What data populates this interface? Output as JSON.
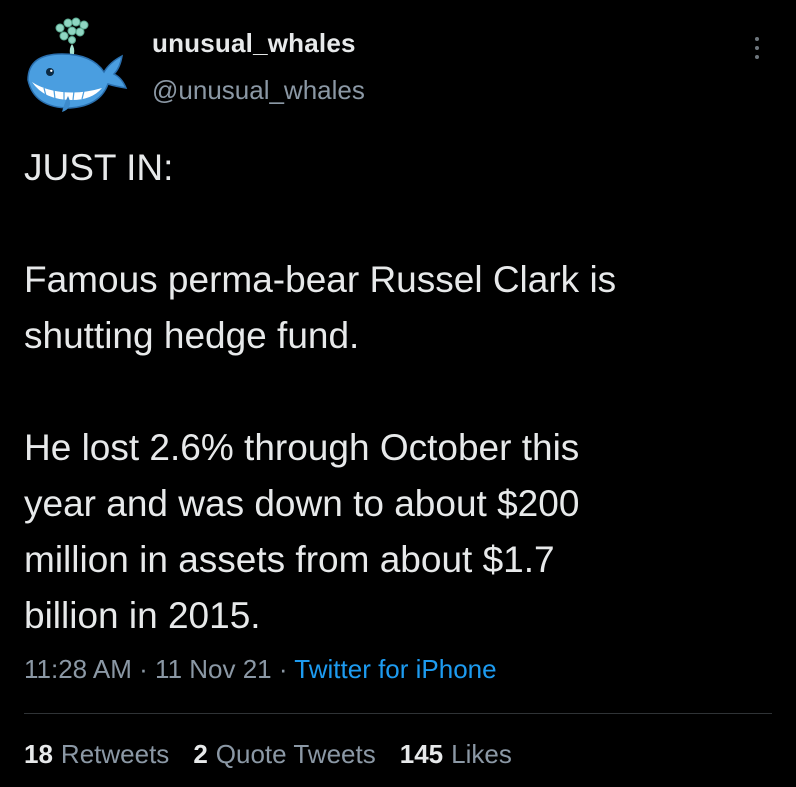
{
  "author": {
    "display_name": "unusual_whales",
    "handle": "@unusual_whales",
    "avatar_icon": "whale-icon"
  },
  "tweet": {
    "paragraphs": [
      "JUST IN:",
      "Famous perma-bear Russel Clark is\nshutting hedge fund.",
      "He lost 2.6% through October this\nyear and was down to about $200\nmillion in assets from about $1.7\nbillion in 2015."
    ]
  },
  "meta": {
    "time": "11:28 AM",
    "separator": " · ",
    "date": "11 Nov 21",
    "source": "Twitter for iPhone"
  },
  "stats": {
    "retweets": {
      "count": "18",
      "label": "Retweets"
    },
    "quotes": {
      "count": "2",
      "label": "Quote Tweets"
    },
    "likes": {
      "count": "145",
      "label": "Likes"
    }
  },
  "colors": {
    "background": "#000000",
    "text": "#e7e9ea",
    "secondary": "#8b98a5",
    "link": "#1d9bf0",
    "divider": "#2f3336"
  }
}
